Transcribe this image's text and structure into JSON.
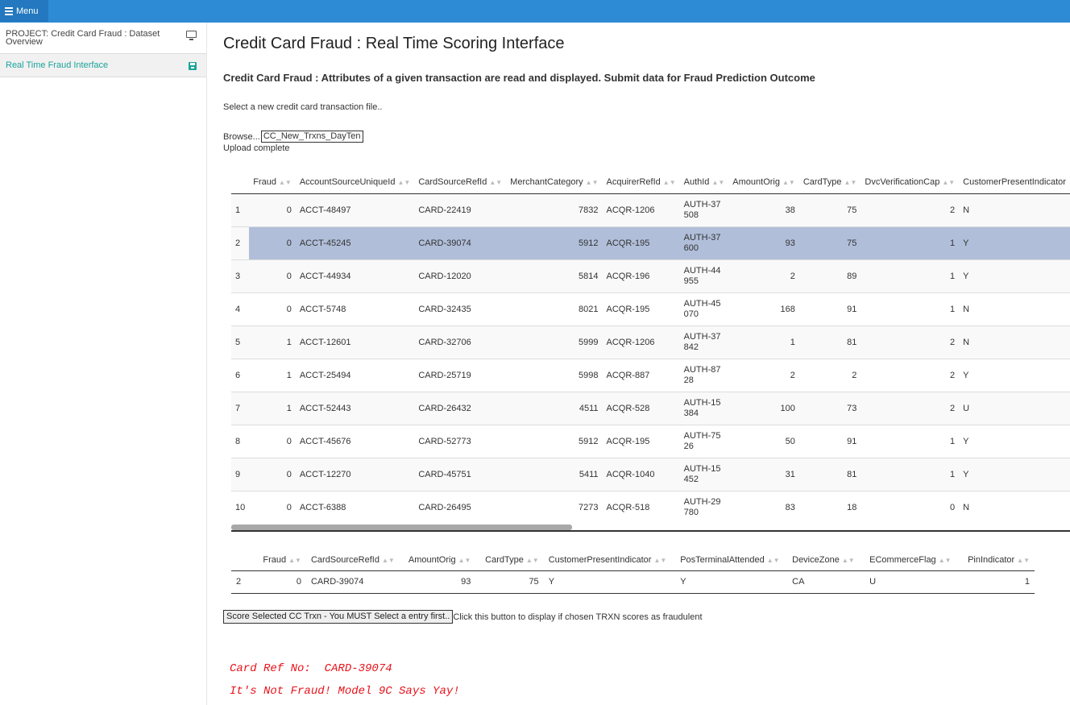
{
  "topbar": {
    "menu_label": "Menu"
  },
  "sidebar": {
    "items": [
      {
        "label": "PROJECT: Credit Card Fraud : Dataset Overview",
        "icon": "monitor-icon"
      },
      {
        "label": "Real Time Fraud Interface",
        "icon": "save-icon"
      }
    ]
  },
  "main": {
    "title": "Credit Card Fraud : Real Time Scoring Interface",
    "subtitle": "Credit Card Fraud : Attributes of a given transaction are read and displayed. Submit data for Fraud Prediction Outcome",
    "select_label": "Select a new credit card transaction file..",
    "browse_label": "Browse...",
    "file_name": "CC_New_Trxns_DayTen",
    "upload_status": "Upload complete"
  },
  "transactions": {
    "columns": [
      "",
      "Fraud",
      "AccountSourceUniqueId",
      "CardSourceRefId",
      "MerchantCategory",
      "AcquirerRefId",
      "AuthId",
      "AmountOrig",
      "CardType",
      "DvcVerificationCap",
      "CustomerPresentIndicator"
    ],
    "selected_row": 2,
    "rows": [
      [
        "1",
        "0",
        "ACCT-48497",
        "CARD-22419",
        "7832",
        "ACQR-1206",
        "AUTH-37508",
        "38",
        "75",
        "2",
        "N"
      ],
      [
        "2",
        "0",
        "ACCT-45245",
        "CARD-39074",
        "5912",
        "ACQR-195",
        "AUTH-37600",
        "93",
        "75",
        "1",
        "Y"
      ],
      [
        "3",
        "0",
        "ACCT-44934",
        "CARD-12020",
        "5814",
        "ACQR-196",
        "AUTH-44955",
        "2",
        "89",
        "1",
        "Y"
      ],
      [
        "4",
        "0",
        "ACCT-5748",
        "CARD-32435",
        "8021",
        "ACQR-195",
        "AUTH-45070",
        "168",
        "91",
        "1",
        "N"
      ],
      [
        "5",
        "1",
        "ACCT-12601",
        "CARD-32706",
        "5999",
        "ACQR-1206",
        "AUTH-37842",
        "1",
        "81",
        "2",
        "N"
      ],
      [
        "6",
        "1",
        "ACCT-25494",
        "CARD-25719",
        "5998",
        "ACQR-887",
        "AUTH-8728",
        "2",
        "2",
        "2",
        "Y"
      ],
      [
        "7",
        "1",
        "ACCT-52443",
        "CARD-26432",
        "4511",
        "ACQR-528",
        "AUTH-15384",
        "100",
        "73",
        "2",
        "U"
      ],
      [
        "8",
        "0",
        "ACCT-45676",
        "CARD-52773",
        "5912",
        "ACQR-195",
        "AUTH-7526",
        "50",
        "91",
        "1",
        "Y"
      ],
      [
        "9",
        "0",
        "ACCT-12270",
        "CARD-45751",
        "5411",
        "ACQR-1040",
        "AUTH-15452",
        "31",
        "81",
        "1",
        "Y"
      ],
      [
        "10",
        "0",
        "ACCT-6388",
        "CARD-26495",
        "7273",
        "ACQR-518",
        "AUTH-29780",
        "83",
        "18",
        "0",
        "N"
      ]
    ]
  },
  "selected_txn": {
    "columns": [
      "",
      "Fraud",
      "CardSourceRefId",
      "AmountOrig",
      "CardType",
      "CustomerPresentIndicator",
      "PosTerminalAttended",
      "DeviceZone",
      "ECommerceFlag",
      "PinIndicator"
    ],
    "row": [
      "2",
      "0",
      "CARD-39074",
      "93",
      "75",
      "Y",
      "Y",
      "CA",
      "U",
      "1"
    ]
  },
  "score": {
    "button_label": "Score Selected CC Trxn - You MUST Select a entry first..",
    "hint": "Click this button to display if chosen TRXN scores as fraudulent"
  },
  "result": {
    "line1": "Card Ref No:  CARD-39074",
    "line2": "It's Not Fraud! Model 9C Says Yay!",
    "color": "#e8121b"
  },
  "colors": {
    "topbar": "#2d8bd6",
    "accent": "#1aa39b",
    "selected_row": "#b0bed9"
  }
}
